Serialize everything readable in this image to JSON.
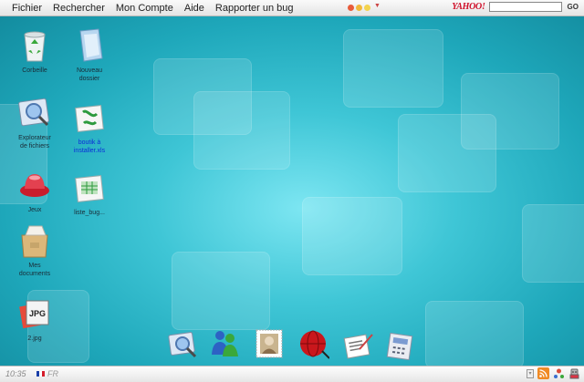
{
  "menubar": {
    "items": [
      "Fichier",
      "Rechercher",
      "Mon Compte",
      "Aide",
      "Rapporter un bug"
    ],
    "window_dots": [
      "#e85b3a",
      "#f1b83a",
      "#f3d34e"
    ],
    "search": {
      "logo": "YAHOO!",
      "go_label": "GO",
      "value": ""
    }
  },
  "desktop": {
    "icons": [
      {
        "label": "Corbeille",
        "icon": "recycle-bin-icon"
      },
      {
        "label": "Nouveau dossier",
        "icon": "folder-icon"
      },
      {
        "label": "Explorateur de fichiers",
        "icon": "file-explorer-icon"
      },
      {
        "label": "boutik à installer.xls",
        "icon": "spreadsheet-file-icon"
      },
      {
        "label": "Jeux",
        "icon": "games-icon"
      },
      {
        "label": "liste_bug...",
        "icon": "spreadsheet-file-icon"
      },
      {
        "label": "Mes documents",
        "icon": "documents-box-icon"
      },
      {
        "label": "2.jpg",
        "icon": "jpg-file-icon"
      }
    ]
  },
  "dock": {
    "items": [
      "explorer-icon",
      "messenger-icon",
      "mail-stamp-icon",
      "web-browser-icon",
      "text-editor-icon",
      "calculator-icon"
    ]
  },
  "bottombar": {
    "clock": "10:35",
    "lang": "FR"
  },
  "colors": {
    "desktop": "#2bb8c8",
    "selected_label": "#0b2dd8"
  }
}
